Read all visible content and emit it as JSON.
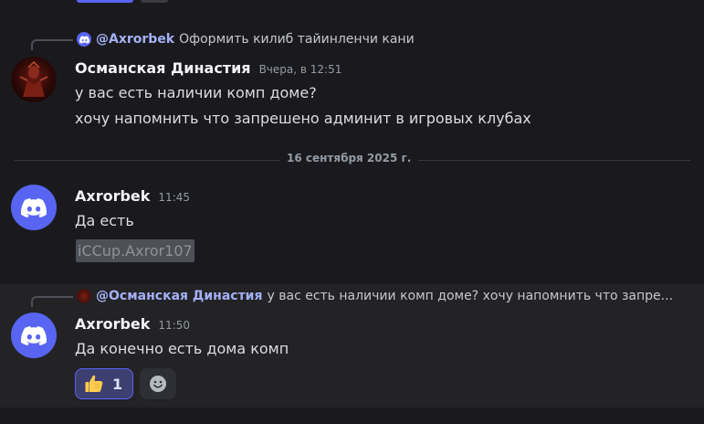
{
  "messages": [
    {
      "reply": {
        "author": "@Axrorbek",
        "text": "Оформить килиб тайинленчи кани"
      },
      "author": "Османская Династия",
      "time": "Вчера, в 12:51",
      "lines": [
        "у вас есть наличии комп доме?",
        "хочу напомнить что запрешено админит в игровых клубах"
      ]
    },
    {
      "author": "Axrorbek",
      "time": "11:45",
      "lines": [
        "Да есть"
      ],
      "spoiler": "iCCup.Axror107"
    },
    {
      "reply": {
        "author": "@Османская Династия",
        "text": "у вас есть наличии комп доме? хочу напомнить что запре..."
      },
      "author": "Axrorbek",
      "time": "11:50",
      "lines": [
        "Да конечно есть дома комп"
      ],
      "reaction": {
        "emoji": "thumbs-up",
        "count": "1"
      }
    }
  ],
  "divider": {
    "label": "16 сентября 2025 г."
  },
  "colors": {
    "background": "#1a1a1e",
    "accent": "#5865f2",
    "mention": "#a4b0f4"
  }
}
